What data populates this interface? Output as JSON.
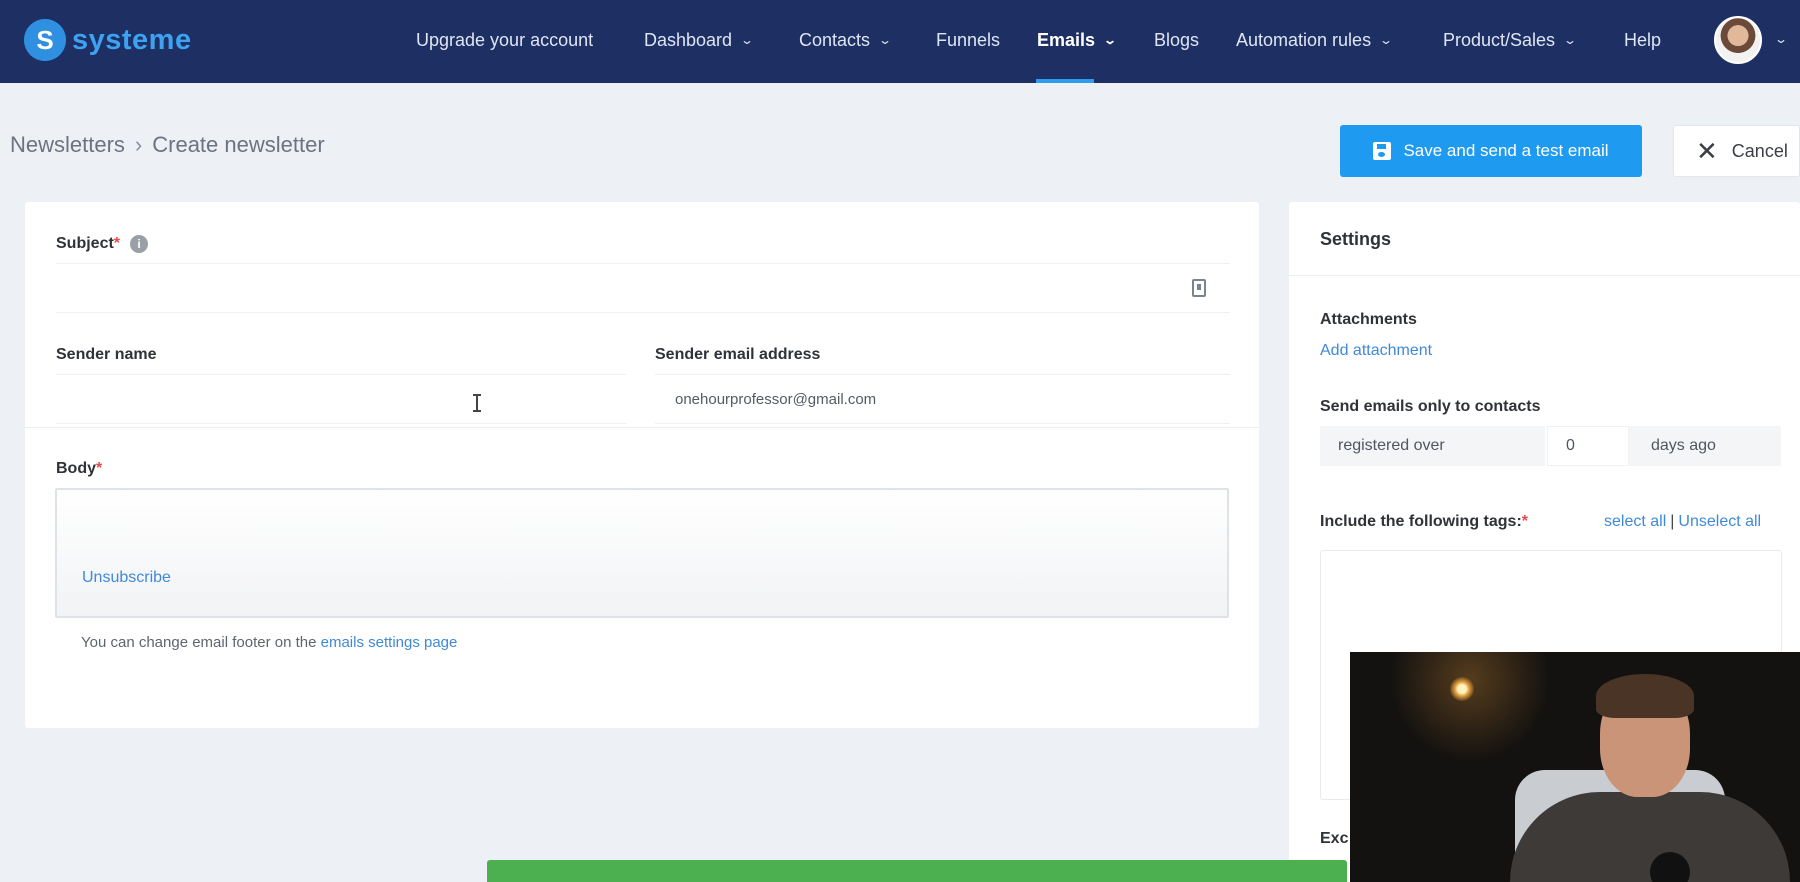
{
  "nav": {
    "brand": "systeme",
    "items": [
      {
        "label": "Upgrade your account",
        "has_dropdown": false
      },
      {
        "label": "Dashboard",
        "has_dropdown": true
      },
      {
        "label": "Contacts",
        "has_dropdown": true
      },
      {
        "label": "Funnels",
        "has_dropdown": false
      },
      {
        "label": "Emails",
        "has_dropdown": true,
        "active": true
      },
      {
        "label": "Blogs",
        "has_dropdown": false
      },
      {
        "label": "Automation rules",
        "has_dropdown": true
      },
      {
        "label": "Product/Sales",
        "has_dropdown": true
      },
      {
        "label": "Help",
        "has_dropdown": false
      }
    ],
    "chevron": "⌄"
  },
  "breadcrumb": {
    "parent": "Newsletters",
    "separator": "›",
    "current": "Create newsletter"
  },
  "actions": {
    "save_test": "Save and send a test email",
    "cancel": "Cancel"
  },
  "form": {
    "subject_label": "Subject",
    "required_mark": "*",
    "info_glyph": "i",
    "subject_value": "",
    "sender_name_label": "Sender name",
    "sender_name_value": "",
    "sender_email_label": "Sender email address",
    "sender_email_value": "onehourprofessor@gmail.com",
    "body_label": "Body",
    "unsubscribe_link": "Unsubscribe",
    "footer_note_text": "You can change email footer on the ",
    "footer_note_link": "emails settings page"
  },
  "settings": {
    "title": "Settings",
    "attachments_label": "Attachments",
    "add_attachment": "Add attachment",
    "send_only_label": "Send emails only to contacts",
    "registered_option": "registered over",
    "days_value": "0",
    "days_suffix": "days ago",
    "tags_label": "Include the following tags:",
    "select_all": "select all",
    "pipe": "|",
    "unselect_all": "Unselect all",
    "exclude_label_partial": "Exc"
  },
  "colors": {
    "navbar": "#1d2f63",
    "accent": "#1f9af1",
    "link": "#3f8ad8",
    "required": "#e5484d",
    "toast": "#4caf50"
  },
  "icons": {
    "logo": "systeme-logo-icon",
    "save": "floppy-disk-icon",
    "cancel": "close-icon",
    "info": "info-icon",
    "field_helper": "clipboard-icon",
    "dropdown": "chevron-down-icon"
  }
}
